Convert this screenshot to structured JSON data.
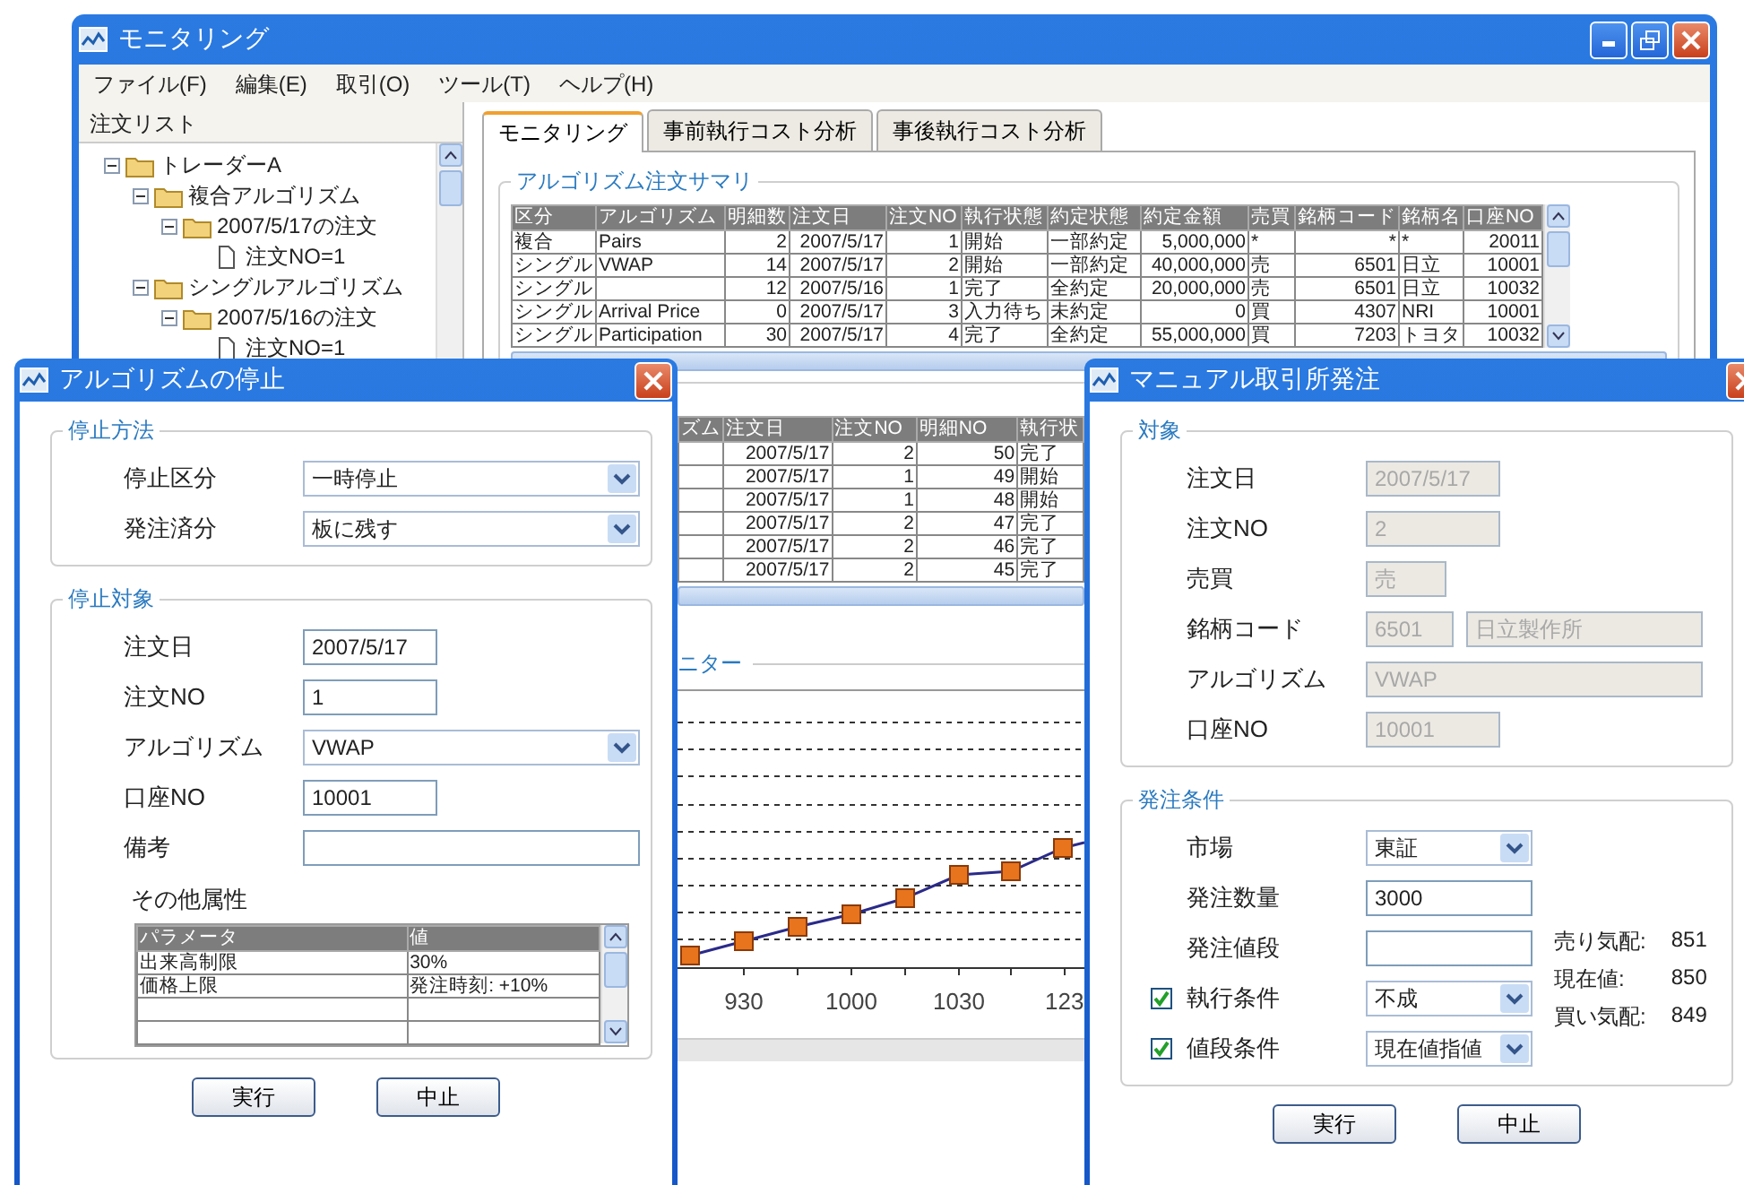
{
  "main_window": {
    "title": "モニタリング"
  },
  "menu": [
    "ファイル(F)",
    "編集(E)",
    "取引(O)",
    "ツール(T)",
    "ヘルプ(H)"
  ],
  "order_list": {
    "title": "注文リスト",
    "tree": [
      {
        "kind": "folder",
        "label": "トレーダーA",
        "expanded": true,
        "children": [
          {
            "kind": "folder",
            "label": "複合アルゴリズム",
            "expanded": true,
            "children": [
              {
                "kind": "folder",
                "label": "2007/5/17の注文",
                "expanded": true,
                "children": [
                  {
                    "kind": "file",
                    "label": "注文NO=1"
                  }
                ]
              }
            ]
          },
          {
            "kind": "folder",
            "label": "シングルアルゴリズム",
            "expanded": true,
            "children": [
              {
                "kind": "folder",
                "label": "2007/5/16の注文",
                "expanded": true,
                "children": [
                  {
                    "kind": "file",
                    "label": "注文NO=1"
                  }
                ]
              }
            ]
          }
        ]
      }
    ]
  },
  "tabs": [
    {
      "label": "モニタリング",
      "selected": true
    },
    {
      "label": "事前執行コスト分析",
      "selected": false
    },
    {
      "label": "事後執行コスト分析",
      "selected": false
    }
  ],
  "summary": {
    "title": "アルゴリズム注文サマリ",
    "columns": [
      {
        "label": "区分",
        "numeric": false
      },
      {
        "label": "アルゴリズム",
        "numeric": false
      },
      {
        "label": "明細数",
        "numeric": true
      },
      {
        "label": "注文日",
        "numeric": true
      },
      {
        "label": "注文NO",
        "numeric": true
      },
      {
        "label": "執行状態",
        "numeric": false
      },
      {
        "label": "約定状態",
        "numeric": false
      },
      {
        "label": "約定金額",
        "numeric": true
      },
      {
        "label": "売買",
        "numeric": false
      },
      {
        "label": "銘柄コード",
        "numeric": true
      },
      {
        "label": "銘柄名",
        "numeric": false
      },
      {
        "label": "口座NO",
        "numeric": true
      }
    ],
    "rows": [
      [
        "複合",
        "Pairs",
        "2",
        "2007/5/17",
        "1",
        "開始",
        "一部約定",
        "5,000,000",
        "*",
        "*",
        "*",
        "20011"
      ],
      [
        "シングル",
        "VWAP",
        "14",
        "2007/5/17",
        "2",
        "開始",
        "一部約定",
        "40,000,000",
        "売",
        "6501",
        "日立",
        "10001"
      ],
      [
        "シングル",
        "",
        "12",
        "2007/5/16",
        "1",
        "完了",
        "全約定",
        "20,000,000",
        "売",
        "6501",
        "日立",
        "10032"
      ],
      [
        "シングル",
        "Arrival Price",
        "0",
        "2007/5/17",
        "3",
        "入力待ち",
        "未約定",
        "0",
        "買",
        "4307",
        "NRI",
        "10001"
      ],
      [
        "シングル",
        "Participation",
        "30",
        "2007/5/17",
        "4",
        "完了",
        "全約定",
        "55,000,000",
        "買",
        "7203",
        "トヨタ",
        "10032"
      ]
    ]
  },
  "detail": {
    "columns": [
      {
        "label": "ズム"
      },
      {
        "label": "注文日",
        "numeric": true
      },
      {
        "label": "注文NO",
        "numeric": true
      },
      {
        "label": "明細NO",
        "numeric": true
      },
      {
        "label": "執行状",
        "numeric": false
      }
    ],
    "rows": [
      [
        "",
        "2007/5/17",
        "2",
        "50",
        "完了"
      ],
      [
        "",
        "2007/5/17",
        "1",
        "49",
        "開始"
      ],
      [
        "",
        "2007/5/17",
        "1",
        "48",
        "開始"
      ],
      [
        "",
        "2007/5/17",
        "2",
        "47",
        "完了"
      ],
      [
        "",
        "2007/5/17",
        "2",
        "46",
        "完了"
      ],
      [
        "",
        "2007/5/17",
        "2",
        "45",
        "完了"
      ]
    ]
  },
  "monitor": {
    "title": "ニター",
    "x_labels": [
      "930",
      "1000",
      "1030",
      "123"
    ]
  },
  "stop_dialog": {
    "title": "アルゴリズムの停止",
    "sections": [
      {
        "title": "停止方法",
        "rows": [
          {
            "label": "停止区分",
            "inputs": [
              {
                "kind": "select-long",
                "value": "一時停止"
              }
            ]
          },
          {
            "label": "発注済分",
            "inputs": [
              {
                "kind": "select-long",
                "value": "板に残す"
              }
            ]
          }
        ]
      },
      {
        "title": "停止対象",
        "rows": [
          {
            "label": "注文日",
            "inputs": [
              {
                "kind": "short",
                "value": "2007/5/17"
              }
            ]
          },
          {
            "label": "注文NO",
            "inputs": [
              {
                "kind": "short",
                "value": "1"
              }
            ]
          },
          {
            "label": "アルゴリズム",
            "inputs": [
              {
                "kind": "select-long",
                "value": "VWAP"
              }
            ]
          },
          {
            "label": "口座NO",
            "inputs": [
              {
                "kind": "short",
                "value": "10001"
              }
            ]
          },
          {
            "label": "備考",
            "inputs": [
              {
                "kind": "long"
              }
            ]
          }
        ],
        "attributes": {
          "label": "その他属性",
          "columns": [
            "パラメータ",
            "値"
          ],
          "rows": [
            [
              "出来高制限",
              "30%"
            ],
            [
              "価格上限",
              "発注時刻: +10%"
            ]
          ]
        }
      }
    ],
    "buttons": [
      "実行",
      "中止"
    ]
  },
  "order_dialog": {
    "title": "マニュアル取引所発注",
    "sections": [
      {
        "title": "対象",
        "rows": [
          {
            "label": "注文日",
            "inputs": [
              {
                "kind": "short",
                "value": "2007/5/17",
                "disabled": true
              }
            ]
          },
          {
            "label": "注文NO",
            "inputs": [
              {
                "kind": "short",
                "value": "2",
                "disabled": true
              }
            ]
          },
          {
            "label": "売買",
            "inputs": [
              {
                "kind": "tiny",
                "value": "売",
                "disabled": true
              }
            ]
          },
          {
            "label": "銘柄コード",
            "inputs": [
              {
                "kind": "code",
                "value": "6501",
                "disabled": true
              },
              {
                "kind": "name",
                "value": "日立製作所",
                "disabled": true
              }
            ]
          },
          {
            "label": "アルゴリズム",
            "inputs": [
              {
                "kind": "long",
                "value": "VWAP",
                "disabled": true
              }
            ]
          },
          {
            "label": "口座NO",
            "inputs": [
              {
                "kind": "short",
                "value": "10001",
                "disabled": true
              }
            ]
          }
        ]
      },
      {
        "title": "発注条件",
        "rows": [
          {
            "label": "市場",
            "inputs": [
              {
                "kind": "select-medium",
                "value": "東証"
              }
            ]
          },
          {
            "label": "発注数量",
            "inputs": [
              {
                "kind": "medium",
                "value": "3000",
                "disabled": false
              }
            ]
          },
          {
            "label": "発注値段",
            "inputs": [
              {
                "kind": "medium",
                "disabled": false
              }
            ]
          },
          {
            "label": "執行条件",
            "checked": true,
            "inputs": [
              {
                "kind": "select-medium",
                "value": "不成"
              }
            ]
          },
          {
            "label": "値段条件",
            "checked": true,
            "inputs": [
              {
                "kind": "select-medium",
                "value": "現在値指値"
              }
            ]
          }
        ],
        "quotes": [
          {
            "label": "売り気配:",
            "value": "851"
          },
          {
            "label": "現在値:",
            "value": "850"
          },
          {
            "label": "買い気配:",
            "value": "849"
          }
        ]
      }
    ],
    "buttons": [
      "実行",
      "中止"
    ]
  }
}
